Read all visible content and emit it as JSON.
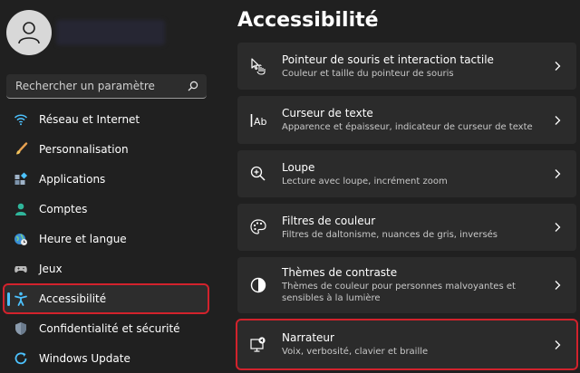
{
  "search": {
    "placeholder": "Rechercher un paramètre"
  },
  "sidebar": {
    "items": [
      {
        "label": "Réseau et Internet",
        "icon": "wifi-icon",
        "selected": false
      },
      {
        "label": "Personnalisation",
        "icon": "brush-icon",
        "selected": false
      },
      {
        "label": "Applications",
        "icon": "apps-icon",
        "selected": false
      },
      {
        "label": "Comptes",
        "icon": "person-icon",
        "selected": false
      },
      {
        "label": "Heure et langue",
        "icon": "globe-clock-icon",
        "selected": false
      },
      {
        "label": "Jeux",
        "icon": "gamepad-icon",
        "selected": false
      },
      {
        "label": "Accessibilité",
        "icon": "accessibility-icon",
        "selected": true
      },
      {
        "label": "Confidentialité et sécurité",
        "icon": "shield-icon",
        "selected": false
      },
      {
        "label": "Windows Update",
        "icon": "update-icon",
        "selected": false
      }
    ]
  },
  "main": {
    "title": "Accessibilité",
    "cards": [
      {
        "title": "Pointeur de souris et interaction tactile",
        "subtitle": "Couleur et taille du pointeur de souris",
        "icon": "pointer-touch-icon"
      },
      {
        "title": "Curseur de texte",
        "subtitle": "Apparence et épaisseur, indicateur de curseur de texte",
        "icon": "text-cursor-icon"
      },
      {
        "title": "Loupe",
        "subtitle": "Lecture avec loupe, incrément zoom",
        "icon": "magnifier-icon"
      },
      {
        "title": "Filtres de couleur",
        "subtitle": "Filtres de daltonisme, nuances de gris, inversés",
        "icon": "palette-icon"
      },
      {
        "title": "Thèmes de contraste",
        "subtitle": "Thèmes de couleur pour personnes malvoyantes et sensibles à la lumière",
        "icon": "contrast-icon"
      },
      {
        "title": "Narrateur",
        "subtitle": "Voix, verbosité, clavier et braille",
        "icon": "narrator-icon",
        "highlighted": true
      }
    ]
  },
  "colors": {
    "accent": "#4cc2ff",
    "highlight_border": "#d2222c",
    "background": "#202020",
    "card": "#2b2b2b"
  }
}
